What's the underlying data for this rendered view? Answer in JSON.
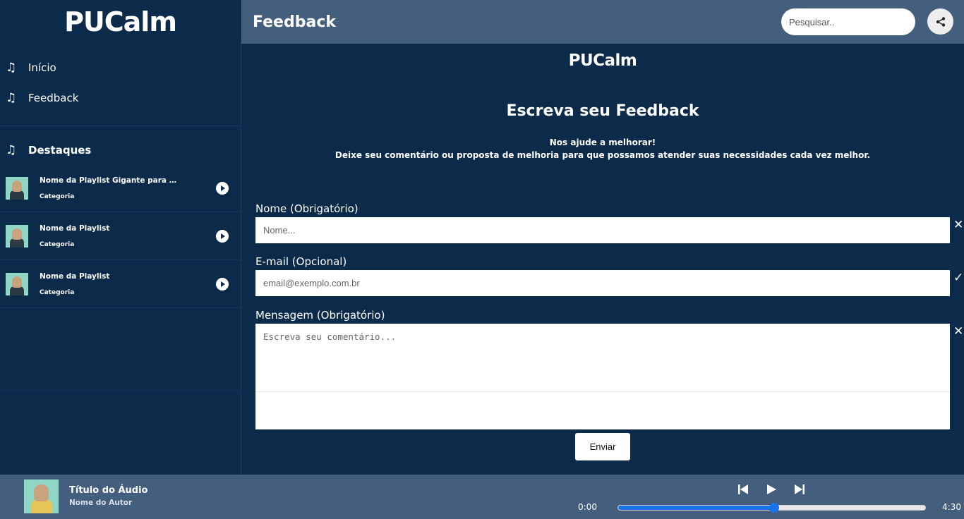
{
  "sidebar": {
    "logo": "PUCalm",
    "nav": [
      {
        "label": "Início",
        "icon": "music-note-icon"
      },
      {
        "label": "Feedback",
        "icon": "music-note-icon"
      }
    ],
    "highlights_title": "Destaques",
    "playlists": [
      {
        "title": "Nome da Playlist Gigante para Med...",
        "category": "Categoria"
      },
      {
        "title": "Nome da Playlist",
        "category": "Categoria"
      },
      {
        "title": "Nome da Playlist",
        "category": "Categoria"
      }
    ]
  },
  "header": {
    "title": "Feedback",
    "search_placeholder": "Pesquisar..",
    "share_icon": "share-icon"
  },
  "main": {
    "logo": "PUCalm",
    "title": "Escreva seu Feedback",
    "subtitle_1": "Nos ajude a melhorar!",
    "subtitle_2": "Deixe seu comentário ou proposta de melhoria para que possamos atender suas necessidades cada vez melhor.",
    "form": {
      "name_label": "Nome (Obrigatório)",
      "name_placeholder": "Nome...",
      "name_status": "✕",
      "email_label": "E-mail (Opcional)",
      "email_placeholder": "email@exemplo.com.br",
      "email_status": "✓",
      "message_label": "Mensagem (Obrigatório)",
      "message_placeholder": "Escreva seu comentário...",
      "message_status": "✕",
      "submit_label": "Enviar"
    }
  },
  "player": {
    "track_title": "Título do Áudio",
    "track_author": "Nome do Autor",
    "current_time": "0:00",
    "total_time": "4:30",
    "progress": 0.508
  },
  "colors": {
    "background": "#0c2a4a",
    "header": "#445f7e",
    "accent": "#1a73e8"
  }
}
